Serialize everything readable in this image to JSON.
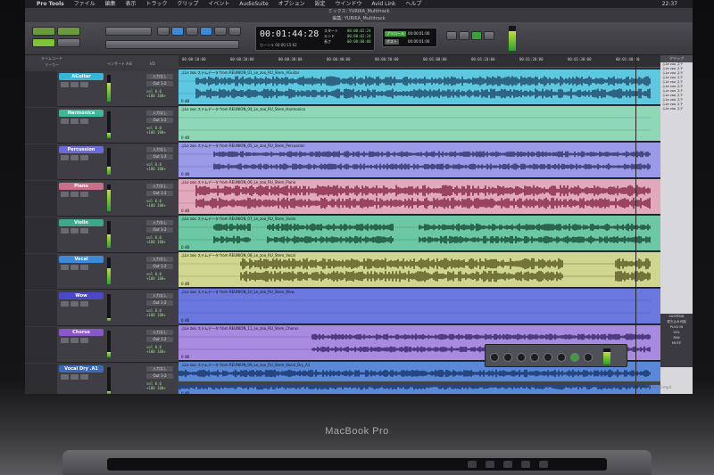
{
  "menubar": {
    "app": "Pro Tools",
    "items": [
      "ファイル",
      "編集",
      "表示",
      "トラック",
      "クリップ",
      "イベント",
      "AudioSuite",
      "オプション",
      "設定",
      "ウインドウ",
      "Avid Link",
      "ヘルプ"
    ],
    "clock": "22:37"
  },
  "windows": {
    "mix_title": "ミックス: YURIKA_Multitrack",
    "edit_title": "編集: YURIKA_Multitrack"
  },
  "toolbar": {
    "main_counter": "00:01:44:28",
    "counter_cursor_label": "カーソル",
    "counter_cursor_value": "00:00:15:62",
    "start_label": "スタート",
    "end_label": "エンド",
    "length_label": "長さ",
    "start_value": "00:00:02:24",
    "end_value": "00:00:02:24",
    "length_value": "00:00:00:00",
    "pre_label": "プリロール",
    "post_label": "ポスト",
    "pre_value": "00:00:01:00",
    "post_value": "00:00:01:00"
  },
  "ruler": {
    "label": "タイムコード",
    "marker_label": "マーカー",
    "ticks": [
      "00:00:10:00",
      "00:00:20:00",
      "00:00:30:00",
      "00:00:40:00",
      "00:00:50:00",
      "00:01:00:00",
      "00:01:10:00",
      "00:01:20:00",
      "00:01:30:00",
      "00:01:40:00"
    ]
  },
  "tracks": [
    {
      "name": "AGuitar",
      "color": "#38b6d8",
      "lane": "#5ec8e0",
      "wave": "#1b3a5a",
      "clip": "ふLe zoo ステムデータ from REUNION_01_Le_zoo_RU_Stem_AGuitar",
      "io": "入力なし",
      "out": "Out 1-2",
      "meter": 0.7
    },
    {
      "name": "Harmonica",
      "color": "#3fb89a",
      "lane": "#8ed8b8",
      "wave": "#1e4a3a",
      "clip": "ふLe zoo ステムデータ from REUNION_04_Le_zoo_RU_Stem_Harmonica",
      "io": "入力なし",
      "out": "Out 1-2",
      "meter": 0.2
    },
    {
      "name": "Percussion",
      "color": "#6a6ad8",
      "lane": "#9a9ae8",
      "wave": "#24245a",
      "clip": "ふLe zoo ステムデータ from REUNION_05_Le_zoo_RU_Stem_Percussion",
      "io": "入力なし",
      "out": "Out 1-2",
      "meter": 0.3
    },
    {
      "name": "Piano",
      "color": "#c8708a",
      "lane": "#e2a8bc",
      "wave": "#7a1a3a",
      "clip": "ふLe zoo ステムデータ from REUNION_06_Le_zoo_RU_Stem_Piano",
      "io": "入力なし",
      "out": "Out 1-2",
      "meter": 0.8
    },
    {
      "name": "Violin",
      "color": "#3fa88a",
      "lane": "#6cc8a4",
      "wave": "#0e3a2a",
      "clip": "ふLe zoo ステムデータ from REUNION_07_Le_zoo_RU_Stem_Violin",
      "io": "入力なし",
      "out": "Out 1-2",
      "meter": 0.5
    },
    {
      "name": "Vocal",
      "color": "#3d8ad8",
      "lane": "#cfd690",
      "wave": "#4a4a14",
      "clip": "ふLe zoo ステムデータ from REUNION_08_Le_zoo_RU_Stem_Vocal",
      "io": "入力なし",
      "out": "Out 1-2",
      "meter": 0.6
    },
    {
      "name": "Wow",
      "color": "#4a4ac8",
      "lane": "#6a78e0",
      "wave": "#1a1a5a",
      "clip": "ふLe zoo ステムデータ from REUNION_10_Le_zoo_RU_Stem_Wow",
      "io": "入力なし",
      "out": "Out 1-2",
      "meter": 0.1
    },
    {
      "name": "Chorus",
      "color": "#8a58c8",
      "lane": "#a88ae0",
      "wave": "#2a1a5a",
      "clip": "ふLe zoo ステムデータ from REUNION_11_Le_zoo_RU_Stem_Chorus",
      "io": "入力なし",
      "out": "Out 1-2",
      "meter": 0.2
    },
    {
      "name": "Vocal Dry .A1",
      "color": "#3a6ab8",
      "lane": "#5a88d8",
      "wave": "#102a5a",
      "clip": "ふLe zoo ステムデータ from REUNION_09_Le_zoo_RU_Stem_Vocal_Dry_A1",
      "io": "入力なし",
      "out": "Out 1-2",
      "meter": 0.1
    }
  ],
  "track_header_labels": {
    "insert": "インサート A-E",
    "io": "I/O",
    "vol": "vol",
    "vol_val": "0.0",
    "pan": "+100   100+"
  },
  "clip_db": "0 dB",
  "cliplist": {
    "title": "クリップ",
    "items": [
      "ふLe zoo ステ",
      "ふLe zoo ステ",
      "ふLe zoo ステ",
      "ふLe zoo ステ",
      "ふLe zoo ステ",
      "ふLe zoo ステ",
      "ふLe zoo ステ",
      "ふLe zoo ステ",
      "ふLe zoo ステ",
      "ふLe zoo ステ",
      "ふLe zoo ステ"
    ],
    "panel": [
      "SUSPEND",
      "書き込み可能",
      "PLUG IN",
      "VOL",
      "PAN",
      "MUTE"
    ]
  },
  "brand": "MacBook Pro",
  "filename": "17-49-45.mp4"
}
